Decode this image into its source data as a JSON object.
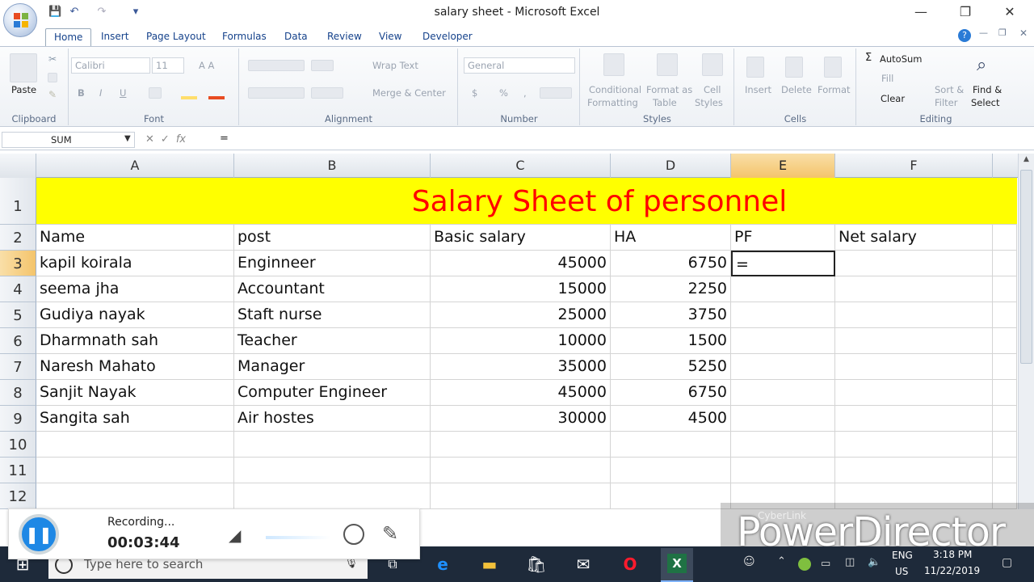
{
  "window": {
    "title": "salary sheet - Microsoft Excel"
  },
  "quick_access": {
    "save": "💾",
    "undo": "↶",
    "redo": "↷",
    "customize": "▾"
  },
  "window_controls": {
    "minimize": "—",
    "restore": "❐",
    "close": "✕",
    "help": "?",
    "ribbon_min": "—",
    "ribbon_restore": "❐",
    "ribbon_close": "✕"
  },
  "tabs": [
    {
      "label": "Home",
      "active": true
    },
    {
      "label": "Insert"
    },
    {
      "label": "Page Layout"
    },
    {
      "label": "Formulas"
    },
    {
      "label": "Data"
    },
    {
      "label": "Review"
    },
    {
      "label": "View"
    },
    {
      "label": "Developer"
    }
  ],
  "ribbon": {
    "clipboard": {
      "label": "Clipboard",
      "paste": "Paste"
    },
    "font": {
      "label": "Font",
      "name": "Calibri",
      "size": "11",
      "bold": "B",
      "italic": "I",
      "underline": "U"
    },
    "alignment": {
      "label": "Alignment",
      "wrap": "Wrap Text",
      "merge": "Merge & Center"
    },
    "number": {
      "label": "Number",
      "format": "General",
      "currency": "$",
      "percent": "%",
      "comma": ","
    },
    "styles": {
      "label": "Styles",
      "conditional": "Conditional",
      "conditional2": "Formatting",
      "format_table": "Format as",
      "format_table2": "Table",
      "cell_styles": "Cell",
      "cell_styles2": "Styles"
    },
    "cells": {
      "label": "Cells",
      "insert": "Insert",
      "delete": "Delete",
      "format": "Format"
    },
    "editing": {
      "label": "Editing",
      "autosum": "AutoSum",
      "fill": "Fill",
      "clear": "Clear",
      "sort": "Sort &",
      "sort2": "Filter",
      "find": "Find &",
      "find2": "Select"
    }
  },
  "formula_bar": {
    "name_box": "SUM",
    "fx": "fx",
    "formula": "="
  },
  "columns": [
    "A",
    "B",
    "C",
    "D",
    "E",
    "F"
  ],
  "rows": [
    "1",
    "2",
    "3",
    "4",
    "5",
    "6",
    "7",
    "8",
    "9",
    "10",
    "11",
    "12"
  ],
  "sheet": {
    "title": "Salary Sheet of personnel",
    "headers": [
      "Name",
      "post",
      "Basic salary",
      "HA",
      "PF",
      "Net salary"
    ],
    "data": [
      [
        "kapil koirala",
        "Enginneer",
        "45000",
        "6750",
        "=",
        ""
      ],
      [
        "seema jha",
        "Accountant",
        "15000",
        "2250",
        "",
        ""
      ],
      [
        "Gudiya nayak",
        "Staft nurse",
        "25000",
        "3750",
        "",
        ""
      ],
      [
        "Dharmnath sah",
        "Teacher",
        "10000",
        "1500",
        "",
        ""
      ],
      [
        "Naresh Mahato",
        "Manager",
        "35000",
        "5250",
        "",
        ""
      ],
      [
        " Sanjit Nayak",
        "Computer Engineer",
        "45000",
        "6750",
        "",
        ""
      ],
      [
        "Sangita sah",
        "Air hostes",
        "30000",
        "4500",
        "",
        ""
      ]
    ]
  },
  "recording": {
    "status": "Recording...",
    "time": "00:03:44"
  },
  "watermark": {
    "small": "CyberLink",
    "big": "PowerDirector"
  },
  "taskbar": {
    "search": "Type here to search",
    "lang": "ENG",
    "region": "US",
    "time": "3:18 PM",
    "date": "11/22/2019"
  }
}
